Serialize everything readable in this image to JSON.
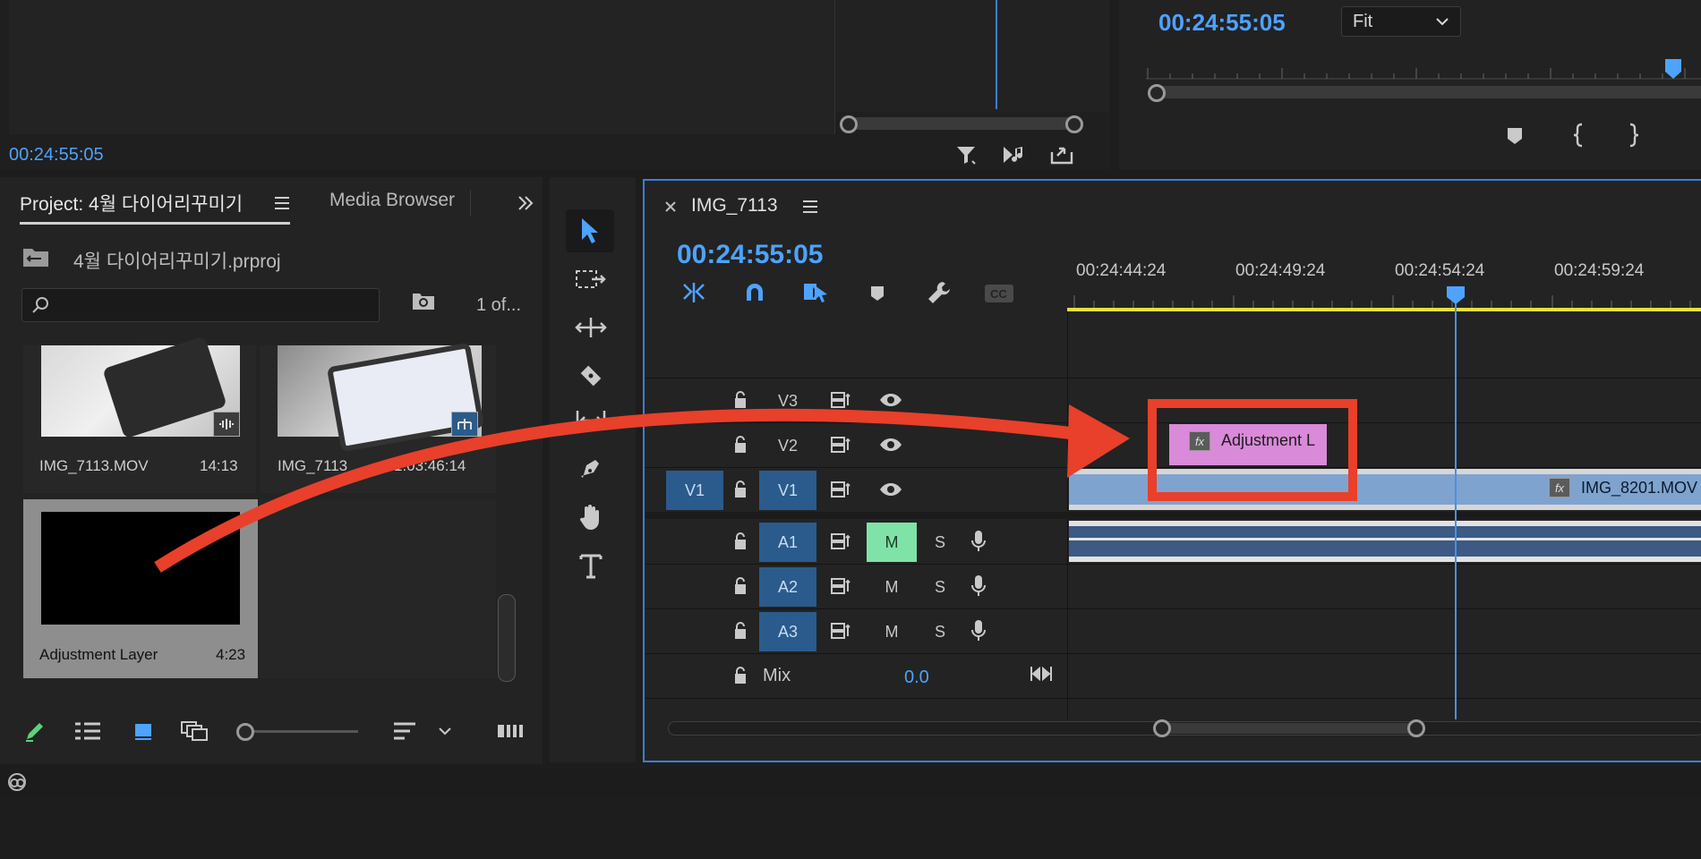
{
  "source_monitor": {
    "timecode": "00:24:55:05"
  },
  "program_monitor": {
    "timecode": "00:24:55:05",
    "zoom_select": "Fit"
  },
  "project_panel": {
    "tab_project": "Project: 4월 다이어리꾸미기",
    "tab_media_browser": "Media Browser",
    "project_file": "4월 다이어리꾸미기.prproj",
    "search_placeholder": "",
    "item_count": "1 of...",
    "items": [
      {
        "name": "IMG_7113.MOV",
        "duration": "14:13"
      },
      {
        "name": "IMG_7113",
        "duration": "1:03:46:14"
      },
      {
        "name": "Adjustment Layer",
        "duration": "4:23"
      }
    ]
  },
  "timeline": {
    "sequence_name": "IMG_7113",
    "timecode": "00:24:55:05",
    "ruler": [
      "00:24:44:24",
      "00:24:49:24",
      "00:24:54:24",
      "00:24:59:24"
    ],
    "video_tracks": [
      {
        "id": "V3",
        "source": ""
      },
      {
        "id": "V2",
        "source": ""
      },
      {
        "id": "V1",
        "source": "V1"
      }
    ],
    "audio_tracks": [
      {
        "id": "A1",
        "mute": "M",
        "solo": "S"
      },
      {
        "id": "A2",
        "mute": "M",
        "solo": "S"
      },
      {
        "id": "A3",
        "mute": "M",
        "solo": "S"
      }
    ],
    "mix_label": "Mix",
    "mix_value": "0.0",
    "clips": {
      "adjustment": "Adjustment L",
      "video": "IMG_8201.MOV",
      "fx": "fx"
    }
  },
  "colors": {
    "accent": "#4da3ff",
    "adjustment_clip": "#d98ad9",
    "video_clip": "#7fa3cf",
    "annotation": "#e8402a",
    "mute_on": "#7fe3a8"
  }
}
